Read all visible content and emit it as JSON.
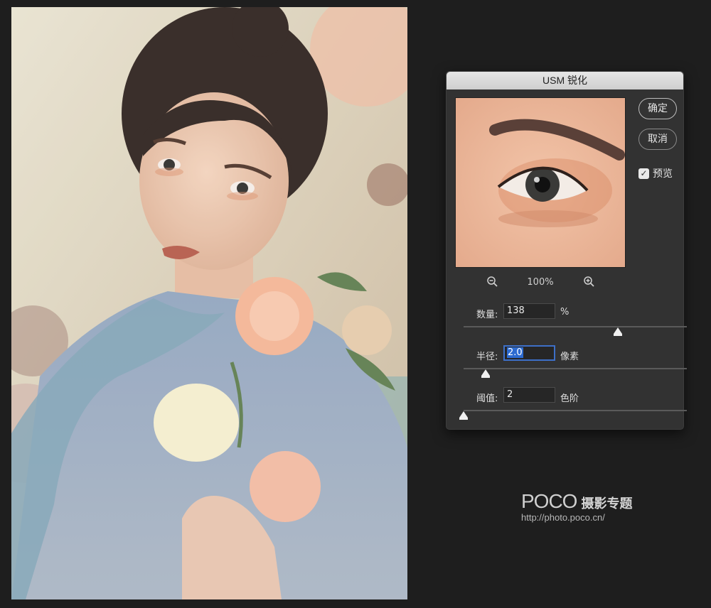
{
  "dialog": {
    "title": "USM 锐化",
    "ok_label": "确定",
    "cancel_label": "取消",
    "preview_label": "预览",
    "preview_checked": true,
    "zoom_level": "100%",
    "amount_label": "数量:",
    "amount_value": "138",
    "amount_unit": "%",
    "amount_slider_fraction": 0.69,
    "radius_label": "半径:",
    "radius_value": "2.0",
    "radius_unit": "像素",
    "radius_slider_fraction": 0.1,
    "threshold_label": "阈值:",
    "threshold_value": "2",
    "threshold_unit": "色阶",
    "threshold_slider_fraction": 0.0
  },
  "watermark": {
    "logo": "POCO",
    "title": "摄影专题",
    "url": "http://photo.poco.cn/"
  },
  "icons": {
    "zoom_out": "zoom-out-icon",
    "zoom_in": "zoom-in-icon",
    "check": "checkmark-icon"
  },
  "colors": {
    "background": "#1e1e1e",
    "dialog": "#323232",
    "selection": "#2d6bd1"
  }
}
